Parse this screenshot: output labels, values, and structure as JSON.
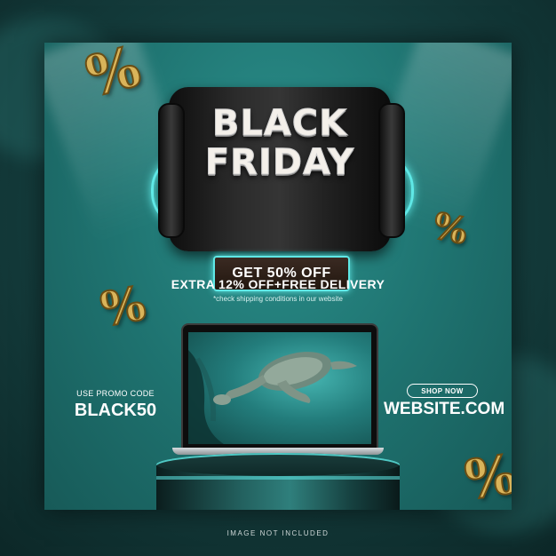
{
  "badge": {
    "line1": "BLACK",
    "line2": "FRIDAY",
    "offer": "GET 50% OFF"
  },
  "headline": "EXTRA 12% OFF+FREE DELIVERY",
  "subnote": "*check shipping conditions in our website",
  "promo": {
    "label": "USE PROMO CODE",
    "code": "BLACK50"
  },
  "shop": {
    "button_label": "SHOP NOW",
    "website": "WEBSITE.COM"
  },
  "decor": {
    "percent_symbol": "%",
    "icons": [
      "percent-icon",
      "turtle-illustration",
      "laptop-mockup",
      "podium"
    ]
  },
  "footer": "IMAGE NOT INCLUDED",
  "colors": {
    "card": "#1f7471",
    "neon": "#5fe8e6",
    "gold": "#d9b45a",
    "text": "#ffffff"
  }
}
